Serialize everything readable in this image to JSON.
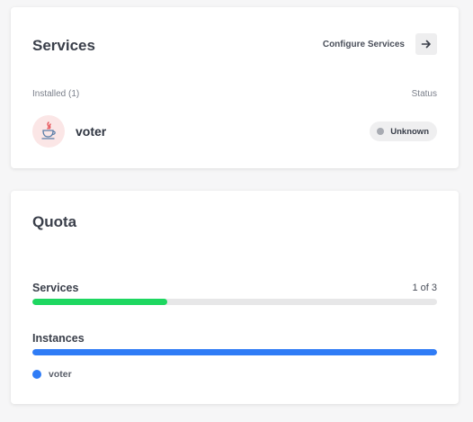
{
  "services_card": {
    "title": "Services",
    "configure_label": "Configure Services",
    "arrow_icon": "arrow-right-icon",
    "installed_label": "Installed (1)",
    "status_label": "Status",
    "items": [
      {
        "name": "voter",
        "icon": "java-icon",
        "status": "Unknown",
        "status_color": "#a8abb2"
      }
    ]
  },
  "quota_card": {
    "title": "Quota",
    "services": {
      "label": "Services",
      "count_text": "1 of 3",
      "used": 1,
      "total": 3,
      "bar_color": "#1ed760"
    },
    "instances": {
      "label": "Instances",
      "fill_fraction": 1.0,
      "bar_color": "#2f7cf6",
      "legend": [
        {
          "name": "voter",
          "color": "#2f7cf6"
        }
      ]
    }
  },
  "colors": {
    "accent_green": "#1ed760",
    "accent_blue": "#2f7cf6",
    "avatar_bg": "#fbe6e6"
  }
}
